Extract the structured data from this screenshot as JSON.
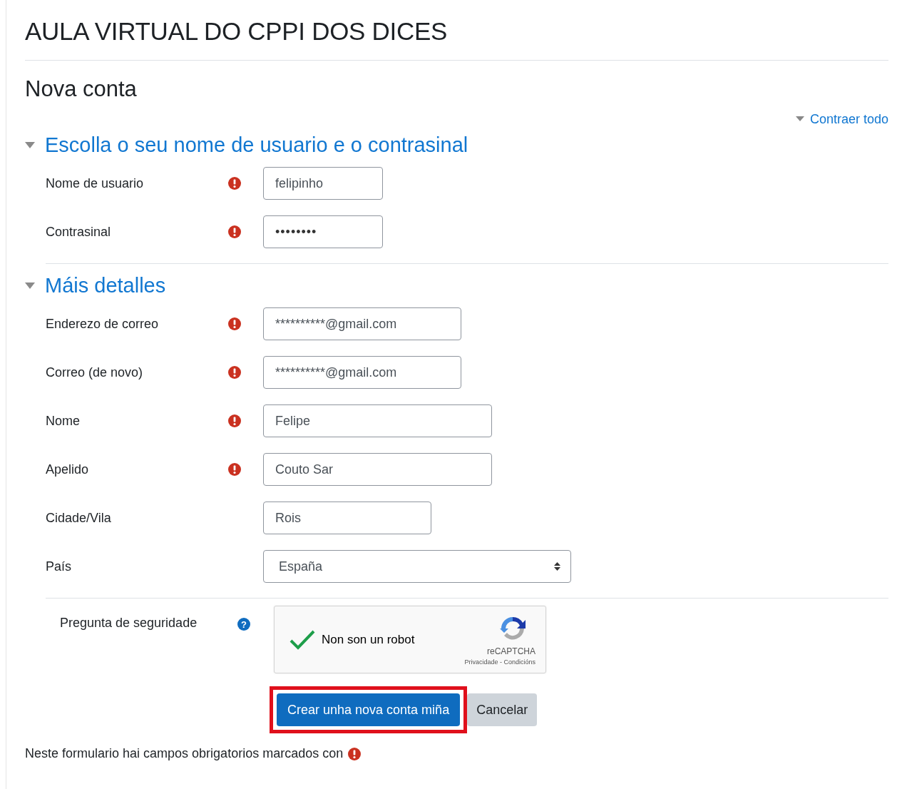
{
  "site_title": "AULA VIRTUAL DO CPPI DOS DICES",
  "page_title": "Nova conta",
  "collapse_link": "Contraer todo",
  "sections": [
    {
      "title": "Escolla o seu nome de usuario e o contrasinal",
      "expanded": true,
      "fields": [
        {
          "label": "Nome de usuario",
          "required": true,
          "kind": "text",
          "value": "felipinho"
        },
        {
          "label": "Contrasinal",
          "required": true,
          "kind": "password",
          "value": "••••••••"
        }
      ]
    },
    {
      "title": "Máis detalles",
      "expanded": true,
      "fields": [
        {
          "label": "Enderezo de correo",
          "required": true,
          "kind": "text",
          "value": "**********@gmail.com"
        },
        {
          "label": "Correo (de novo)",
          "required": true,
          "kind": "text",
          "value": "**********@gmail.com"
        },
        {
          "label": "Nome",
          "required": true,
          "kind": "text",
          "value": "Felipe"
        },
        {
          "label": "Apelido",
          "required": true,
          "kind": "text",
          "value": "Couto Sar"
        },
        {
          "label": "Cidade/Vila",
          "required": false,
          "kind": "text",
          "value": "Rois"
        },
        {
          "label": "País",
          "required": false,
          "kind": "select",
          "value": "España"
        }
      ]
    }
  ],
  "security": {
    "label": "Pregunta de seguridade",
    "help_icon": "?",
    "captcha": {
      "checked": true,
      "text": "Non son un robot",
      "brand": "reCAPTCHA",
      "links": "Privacidade - Condicións"
    }
  },
  "buttons": [
    {
      "label": "Crear unha nova conta miña",
      "kind": "primary",
      "highlighted": true
    },
    {
      "label": "Cancelar",
      "kind": "secondary",
      "highlighted": false
    }
  ],
  "footer_note": "Neste formulario hai campos obrigatorios marcados con"
}
